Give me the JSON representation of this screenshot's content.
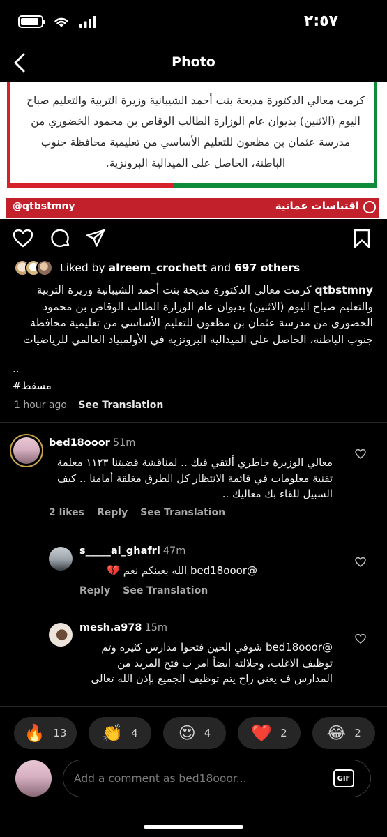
{
  "status_bar": {
    "time": "٢:٥٧",
    "icons": [
      "battery-icon",
      "wifi-icon",
      "signal-icon"
    ],
    "battery_level": 0.9
  },
  "nav": {
    "title": "Photo",
    "back_icon": "chevron-left-icon"
  },
  "post_image": {
    "text": "كرمت معالي الدكتورة مديحة بنت أحمد الشيبانية وزيرة التربية والتعليم صباح اليوم (الاثنين) بديوان عام الوزارة الطالب الوقاص بن محمود الخضوري من مدرسة عثمان بن مظعون للتعليم الأساسي من تعليمية محافظة جنوب الباطنة، الحاصل على الميدالية البرونزية.",
    "handle": "@qtbstmny",
    "brand": "اقتباسات عمانية"
  },
  "actions": {
    "icons": [
      "heart-icon",
      "comment-icon",
      "share-icon",
      "bookmark-icon"
    ]
  },
  "likes": {
    "prefix": "Liked by ",
    "user": "alreem_crochett",
    "middle": " and ",
    "count": "697 others"
  },
  "caption": {
    "user": "qtbstmny",
    "text": "كرمت معالي الدكتورة مديحة بنت أحمد الشيبانية وزيرة التربية والتعليم صباح اليوم (الاثنين) بديوان عام الوزارة الطالب الوقاص بن محمود الخضوري من مدرسة عثمان بن مظعون للتعليم الأساسي من تعليمية محافظة جنوب الباطنة، الحاصل على الميدالية البرونزية في الأولمبياد العالمي للرياضيات",
    "dots": "..",
    "hashtag": "#مسقط",
    "time": "1 hour ago",
    "see_translation": "See Translation"
  },
  "comments": [
    {
      "user": "bed18ooor",
      "time": "51m",
      "text": "معالي الوزيرة خاطري ألتقي فيك .. لمناقشة قضيتنا ١١٢٣ معلمة تقنية معلومات في قائمة الانتظار كل الطرق مغلقة أمامنا .. كيف السبيل للقاء بك معاليك ..",
      "likes": "2 likes",
      "reply": "Reply",
      "see_translation": "See Translation"
    },
    {
      "user": "s_____al_ghafri",
      "time": "47m",
      "text": "@bed18ooor الله يعينكم نعم 💔",
      "reply": "Reply",
      "see_translation": "See Translation"
    },
    {
      "user": "mesh.a978",
      "time": "15m",
      "text": "@bed18ooor شوفي الحين فتحوا مدارس كثيره وتم توظيف الاغلب، وجلالته ايضاً امر ب فتح المزيد من المدارس ف يعني راح يتم توظيف الجميع بإذن الله تعالى"
    }
  ],
  "reactions": [
    {
      "emoji": "🔥",
      "count": "13"
    },
    {
      "emoji": "👏",
      "count": "4"
    },
    {
      "emoji": "😍",
      "count": "4"
    },
    {
      "emoji": "❤️",
      "count": "2"
    },
    {
      "emoji": "😂",
      "count": "2"
    }
  ],
  "composer": {
    "placeholder": "Add a comment as bed18ooor...",
    "gif_label": "GIF"
  },
  "colors": {
    "background": "#000000",
    "secondary_text": "#a8a8a8",
    "pill": "#262626",
    "banner_red": "#c2202b",
    "frame_green": "#0d8a3a"
  }
}
